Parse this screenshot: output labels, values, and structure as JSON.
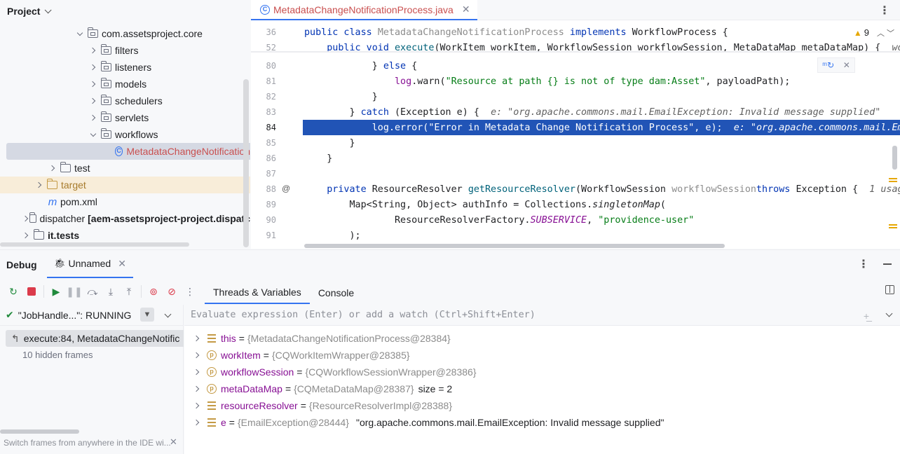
{
  "project": {
    "title": "Project",
    "tree": [
      {
        "label": "com.assetsproject.core",
        "type": "package",
        "expanded": true
      },
      {
        "label": "filters",
        "type": "package"
      },
      {
        "label": "listeners",
        "type": "package"
      },
      {
        "label": "models",
        "type": "package"
      },
      {
        "label": "schedulers",
        "type": "package"
      },
      {
        "label": "servlets",
        "type": "package"
      },
      {
        "label": "workflows",
        "type": "package",
        "expanded": true
      },
      {
        "label": "MetadataChangeNotification",
        "type": "class",
        "selected": true
      },
      {
        "label": "test",
        "type": "folder"
      },
      {
        "label": "target",
        "type": "folder-excluded"
      },
      {
        "label": "pom.xml",
        "type": "maven"
      },
      {
        "label": "dispatcher",
        "suffix": "[aem-assetsproject-project.dispatc",
        "type": "module"
      },
      {
        "label": "it.tests",
        "type": "module"
      }
    ]
  },
  "editor": {
    "tab_label": "MetadataChangeNotificationProcess.java",
    "warnings_count": "9",
    "lines": [
      {
        "n": "36",
        "parts": [
          [
            "kw",
            "public class "
          ],
          [
            "gray",
            "MetadataChangeNotificationProcess "
          ],
          [
            "kw",
            "implements "
          ],
          [
            "",
            "WorkflowProcess {"
          ]
        ]
      },
      {
        "n": "52",
        "parts": [
          [
            "",
            "    "
          ],
          [
            "kw",
            "public void "
          ],
          [
            "fn",
            "execute"
          ],
          [
            "",
            "(WorkItem workItem, WorkflowSession workflowSession, MetaDataMap metaDataMap) {  "
          ],
          [
            "inline-hint",
            "wo"
          ]
        ]
      },
      {
        "n": "80",
        "parts": [
          [
            "",
            "            } "
          ],
          [
            "kw",
            "else"
          ],
          [
            "",
            " {"
          ]
        ]
      },
      {
        "n": "81",
        "parts": [
          [
            "",
            "                "
          ],
          [
            "purple",
            "log"
          ],
          [
            "",
            ".warn("
          ],
          [
            "str",
            "\"Resource at path {} is not of type dam:Asset\""
          ],
          [
            "",
            ", payloadPath);"
          ]
        ]
      },
      {
        "n": "82",
        "parts": [
          [
            "",
            "            }"
          ]
        ]
      },
      {
        "n": "83",
        "parts": [
          [
            "",
            "        } "
          ],
          [
            "kw",
            "catch "
          ],
          [
            "",
            "(Exception e) {  "
          ],
          [
            "inline-hint",
            "e: \"org.apache.commons.mail.EmailException: Invalid message supplied\""
          ]
        ]
      },
      {
        "n": "84",
        "parts": [
          [
            "",
            "            "
          ],
          [
            "purple",
            "log"
          ],
          [
            "",
            ".error("
          ],
          [
            "str",
            "\"Error in Metadata Change Notification Process\""
          ],
          [
            "",
            ", e);  "
          ],
          [
            "inline-hint",
            "e: \"org.apache.commons.mail.Em"
          ]
        ],
        "current": true
      },
      {
        "n": "85",
        "parts": [
          [
            "",
            "        }"
          ]
        ]
      },
      {
        "n": "86",
        "parts": [
          [
            "",
            "    }"
          ]
        ]
      },
      {
        "n": "87",
        "parts": [
          [
            "",
            ""
          ]
        ]
      },
      {
        "n": "88",
        "parts": [
          [
            "",
            "    "
          ],
          [
            "kw",
            "private "
          ],
          [
            "",
            "ResourceResolver "
          ],
          [
            "fn",
            "getResourceResolver"
          ],
          [
            "",
            "(WorkflowSession "
          ],
          [
            "gray",
            "workflowSession"
          ],
          [
            ") "
          ],
          [
            "kw",
            "throws "
          ],
          [
            "",
            "Exception {  "
          ],
          [
            "inline-hint",
            "1 usag"
          ]
        ]
      },
      {
        "n": "89",
        "parts": [
          [
            "",
            "        Map<String, Object> authInfo = Collections."
          ],
          [
            "ital",
            "singletonMap"
          ],
          [
            "",
            "("
          ]
        ]
      },
      {
        "n": "90",
        "parts": [
          [
            "",
            "                ResourceResolverFactory."
          ],
          [
            "purple ital",
            "SUBSERVICE"
          ],
          [
            "",
            ", "
          ],
          [
            "str",
            "\"providence-user\""
          ]
        ]
      },
      {
        "n": "91",
        "parts": [
          [
            "",
            "        );"
          ]
        ]
      }
    ]
  },
  "debug": {
    "title": "Debug",
    "session_tab": "Unnamed",
    "tabs": [
      "Threads & Variables",
      "Console"
    ],
    "thread": "\"JobHandle...\": RUNNING",
    "frame": "execute:84, MetadataChangeNotific",
    "hidden_frames": "10 hidden frames",
    "hint": "Switch frames from anywhere in the IDE wi...",
    "eval_placeholder": "Evaluate expression (Enter) or add a watch (Ctrl+Shift+Enter)",
    "variables": [
      {
        "kind": "field",
        "name": "this",
        "type": "{MetadataChangeNotificationProcess@28384}",
        "extra": "",
        "str": ""
      },
      {
        "kind": "param",
        "name": "workItem",
        "type": "{CQWorkItemWrapper@28385}",
        "extra": "",
        "str": ""
      },
      {
        "kind": "param",
        "name": "workflowSession",
        "type": "{CQWorkflowSessionWrapper@28386}",
        "extra": "",
        "str": ""
      },
      {
        "kind": "param",
        "name": "metaDataMap",
        "type": "{CQMetaDataMap@28387}",
        "extra": "size = 2",
        "str": ""
      },
      {
        "kind": "field",
        "name": "resourceResolver",
        "type": "{ResourceResolverImpl@28388}",
        "extra": "",
        "str": ""
      },
      {
        "kind": "field",
        "name": "e",
        "type": "{EmailException@28444}",
        "extra": "",
        "str": "\"org.apache.commons.mail.EmailException: Invalid message supplied\""
      }
    ]
  },
  "colors": {
    "accent": "#3574f0",
    "current_line": "#2154b6",
    "run_green": "#208a3c",
    "stop_red": "#db3b4b"
  }
}
